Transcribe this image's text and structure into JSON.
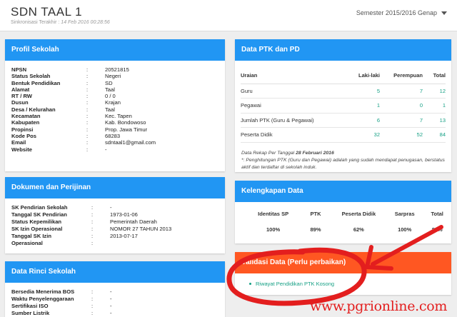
{
  "header": {
    "school_name": "SDN TAAL 1",
    "sync_label": "Sinkronisasi Terakhir :",
    "sync_time": "14 Feb 2016 00:28:56",
    "semester": "Semester 2015/2016 Genap"
  },
  "profil": {
    "title": "Profil Sekolah",
    "rows": [
      {
        "label": "NPSN",
        "value": "20521815"
      },
      {
        "label": "Status Sekolah",
        "value": "Negeri"
      },
      {
        "label": "Bentuk Pendidikan",
        "value": "SD"
      },
      {
        "label": "Alamat",
        "value": "Taal"
      },
      {
        "label": "RT / RW",
        "value": "0 / 0"
      },
      {
        "label": "Dusun",
        "value": "Krajan"
      },
      {
        "label": "Desa / Kelurahan",
        "value": "Taal"
      },
      {
        "label": "Kecamatan",
        "value": "Kec. Tapen"
      },
      {
        "label": "Kabupaten",
        "value": "Kab. Bondowoso"
      },
      {
        "label": "Propinsi",
        "value": "Prop. Jawa Timur"
      },
      {
        "label": "Kode Pos",
        "value": "68283"
      },
      {
        "label": "Email",
        "value": "sdntaal1@gmail.com"
      },
      {
        "label": "Website",
        "value": "-"
      }
    ]
  },
  "dokumen": {
    "title": "Dokumen dan Perijinan",
    "rows": [
      {
        "label": "SK Pendirian Sekolah",
        "value": "-"
      },
      {
        "label": "Tanggal SK Pendirian",
        "value": "1973-01-06"
      },
      {
        "label": "Status Kepemilikan",
        "value": "Pemerintah Daerah"
      },
      {
        "label": "SK Izin Operasional",
        "value": "NOMOR 27 TAHUN 2013"
      },
      {
        "label": "Tanggal SK Izin",
        "value": "2013-07-17"
      },
      {
        "label": "Operasional",
        "value": ""
      }
    ]
  },
  "rinci": {
    "title": "Data Rinci Sekolah",
    "rows": [
      {
        "label": "Bersedia Menerima BOS",
        "value": "-"
      },
      {
        "label": "Waktu Penyelenggaraan",
        "value": "-"
      },
      {
        "label": "Sertifikasi ISO",
        "value": "-"
      },
      {
        "label": "Sumber Listrik",
        "value": "-"
      }
    ]
  },
  "ptk": {
    "title": "Data PTK dan PD",
    "columns": [
      "Uraian",
      "Laki-laki",
      "Perempuan",
      "Total"
    ],
    "rows": [
      [
        "Guru",
        "5",
        "7",
        "12"
      ],
      [
        "Pegawai",
        "1",
        "0",
        "1"
      ],
      [
        "Jumlah PTK (Guru & Pegawai)",
        "6",
        "7",
        "13"
      ],
      [
        "Peserta Didik",
        "32",
        "52",
        "84"
      ]
    ],
    "rekap_label": "Data Rekap Per Tanggal",
    "rekap_date": "28 Februari 2016",
    "footnote": "*: Penghitungan PTK (Guru dan Pegawai) adalah yang sudah mendapat penugasan, berstatus aktif dan terdaftar di sekolah induk."
  },
  "kelengkapan": {
    "title": "Kelengkapan Data",
    "columns": [
      {
        "label": "Identitas SP",
        "value": "100%"
      },
      {
        "label": "PTK",
        "value": "89%"
      },
      {
        "label": "Peserta Didik",
        "value": "62%"
      },
      {
        "label": "Sarpras",
        "value": "100%"
      },
      {
        "label": "Total",
        "value": "88%"
      }
    ]
  },
  "validasi": {
    "title": "Validasi Data (Perlu perbaikan)",
    "items": [
      "Riwayat Pendidikan PTK Kosong"
    ]
  },
  "watermark": "www.pgrionline.com",
  "colors": {
    "primary": "#2196f3",
    "warning": "#ff5722",
    "link": "#16a085",
    "annotation": "#e31e1e"
  }
}
